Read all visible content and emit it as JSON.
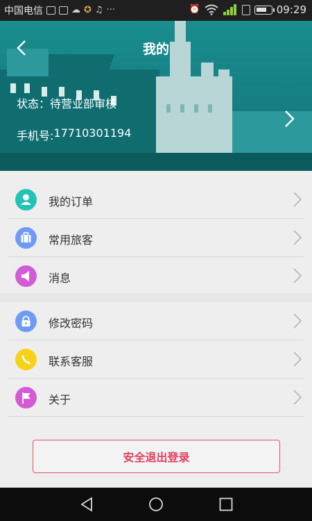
{
  "status_bar": {
    "carrier": "中国电信",
    "time": "09:29",
    "icons": [
      "image-icon",
      "mail-icon",
      "cloud-icon",
      "badge-icon",
      "music-icon",
      "more-icon",
      "alarm-icon",
      "wifi-icon",
      "signal-icon",
      "sim-icon",
      "battery-icon"
    ]
  },
  "header": {
    "title": "我的",
    "status_label": "状态：",
    "status_value": "待营业部审核",
    "phone_label": "手机号: ",
    "phone_value": "17710301194"
  },
  "menu": {
    "group1": [
      {
        "label": "我的订单",
        "icon": "person-icon",
        "color": "#22c2b4"
      },
      {
        "label": "常用旅客",
        "icon": "suitcase-icon",
        "color": "#6f9bf5"
      },
      {
        "label": "消息",
        "icon": "megaphone-icon",
        "color": "#d45bd6"
      }
    ],
    "group2": [
      {
        "label": "修改密码",
        "icon": "lock-icon",
        "color": "#6f9bf5"
      },
      {
        "label": "联系客服",
        "icon": "phone-icon",
        "color": "#f6d21a"
      },
      {
        "label": "关于",
        "icon": "flag-icon",
        "color": "#d45bd6"
      }
    ]
  },
  "logout_label": "安全退出登录",
  "colors": {
    "header_teal": "#1a8d8f",
    "accent_red": "#e0405d"
  }
}
